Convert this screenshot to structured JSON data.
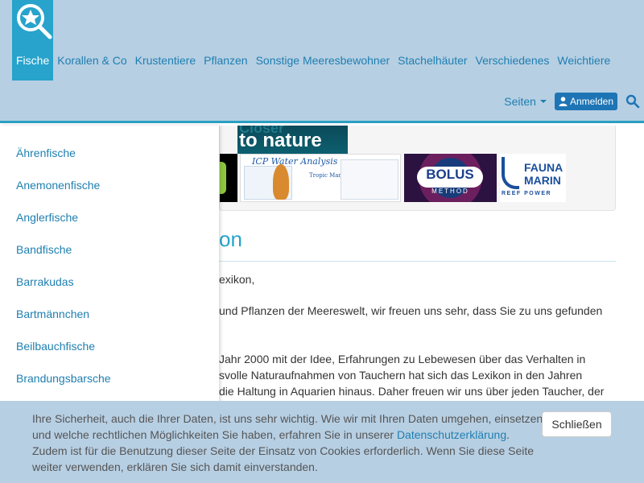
{
  "nav": {
    "items": [
      "Fische",
      "Korallen & Co",
      "Krustentiere",
      "Pflanzen",
      "Sonstige Meeresbewohner",
      "Stachelhäuter",
      "Verschiedenes",
      "Weichtiere"
    ],
    "active_index": 0,
    "seiten_label": "Seiten",
    "login_label": "Anmelden"
  },
  "banner": {
    "ad_nature_text": "to nature",
    "ad_nature_ghost": "Closer",
    "ad_icp_title": "ICP Water Analysis",
    "ad_icp_tag": "Tropic Marin",
    "ad_bolus_title": "BOLUS",
    "ad_bolus_sub": "METHOD",
    "ad_fauna_line1": "FAUNA",
    "ad_fauna_line2": "MARIN",
    "ad_fauna_line3": "REEF POWER"
  },
  "main": {
    "heading": "on",
    "p1": "exikon,",
    "p2a": "und Pflanzen der Meereswelt, wir freuen uns sehr, dass Sie zu uns gefunden",
    "p3a": "Jahr 2000 mit der Idee, Erfahrungen zu Lebewesen über das Verhalten in",
    "p3b": "svolle Naturaufnahmen von Tauchern hat sich das Lexikon in den Jahren",
    "p3c": "die Haltung in Aquarien hinaus. Daher freuen wir uns über jeden Taucher, der"
  },
  "sidebar": {
    "items": [
      "Ährenfische",
      "Anemonenfische",
      "Anglerfische",
      "Bandfische",
      "Barrakudas",
      "Bartmännchen",
      "Beilbauchfische",
      "Brandungsbarsche"
    ]
  },
  "cookie": {
    "text_before_link": "Ihre Sicherheit, auch die Ihrer Daten, ist uns sehr wichtig. Wie wir mit Ihren Daten umgehen, einsetzen und welche rechtlichen Möglichkeiten Sie haben, erfahren Sie in unserer",
    "link_text": "Datenschutzerklärung",
    "text_after_link": ". Zudem ist für die Benutzung dieser Seite der Einsatz von Cookies erforderlich. Wenn Sie diese Seite weiter verwenden, erklären Sie sich damit einverstanden.",
    "close_label": "Schließen"
  },
  "colors": {
    "navbar_bg": "#b7cfe3",
    "accent": "#27a3cc",
    "link": "#1e7fb0",
    "button": "#1e75b5"
  },
  "icons": {
    "logo": "star-magnifier-logo",
    "user": "user-icon",
    "search": "search-icon",
    "caret": "caret-down-icon"
  }
}
